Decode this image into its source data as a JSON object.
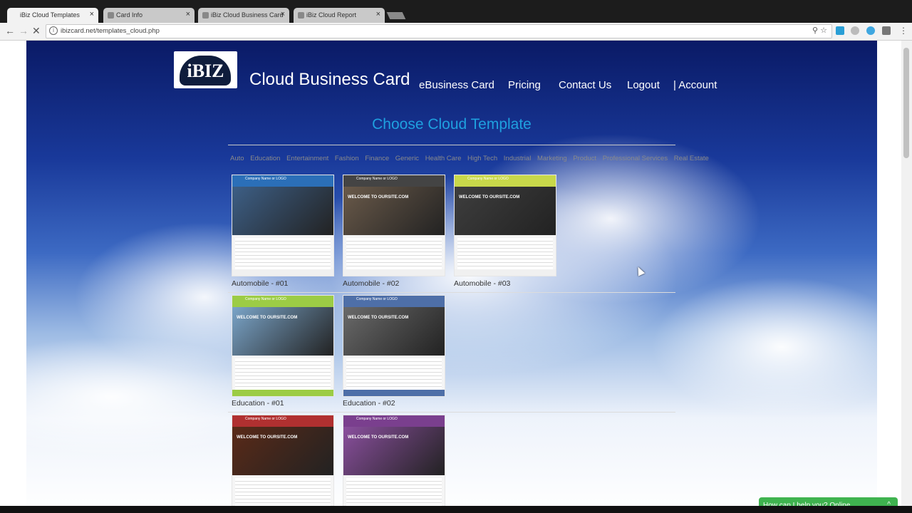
{
  "browser": {
    "tabs": [
      {
        "title": "iBiz Cloud Templates",
        "active": true
      },
      {
        "title": "Card Info",
        "active": false
      },
      {
        "title": "iBiz Cloud Business Card",
        "active": false
      },
      {
        "title": "iBiz Cloud Report",
        "active": false
      }
    ],
    "close_glyph": "×",
    "url": "ibizcard.net/templates_cloud.php"
  },
  "site": {
    "logo_text": "iBIZ",
    "brand_title": "Cloud Business Card",
    "nav": [
      "eBusiness Card",
      "Pricing",
      "Contact Us",
      "Logout",
      "| Account"
    ]
  },
  "templates": {
    "title": "Choose Cloud Template",
    "categories": [
      "Auto",
      "Education",
      "Entertainment",
      "Fashion",
      "Finance",
      "Generic",
      "Health Care",
      "High Tech",
      "Industrial",
      "Marketing",
      "Product",
      "Professional Services",
      "Real Estate"
    ],
    "items": [
      {
        "caption": "Automobile - #01",
        "header_text": "Company Name or LOGO",
        "welcome": "",
        "header_color": "#2b6fb8",
        "photo_color": "#3d5f86",
        "footer_color": "#f0f0f0"
      },
      {
        "caption": "Automobile - #02",
        "header_text": "Company Name or LOGO",
        "welcome": "WELCOME TO OURSITE.COM",
        "header_color": "#444444",
        "photo_color": "#6a5a4a",
        "footer_color": "#f0f0f0"
      },
      {
        "caption": "Automobile - #03",
        "header_text": "Company Name or LOGO",
        "welcome": "WELCOME TO OURSITE.COM",
        "header_color": "#c8d84a",
        "photo_color": "#3e3e3e",
        "footer_color": "#f0f0f0"
      },
      {
        "caption": "Education - #01",
        "header_text": "Company Name or LOGO",
        "welcome": "WELCOME TO OURSITE.COM",
        "header_color": "#9ccc45",
        "photo_color": "#7aa4c8",
        "footer_color": "#9ccc45"
      },
      {
        "caption": "Education - #02",
        "header_text": "Company Name or LOGO",
        "welcome": "WELCOME TO OURSITE.COM",
        "header_color": "#4e6fa8",
        "photo_color": "#6a6a6a",
        "footer_color": "#4e6fa8"
      },
      {
        "caption": "",
        "header_text": "Company Name or LOGO",
        "welcome": "WELCOME TO OURSITE.COM",
        "header_color": "#b03030",
        "photo_color": "#5a2a18",
        "footer_color": "#f0f0f0"
      },
      {
        "caption": "",
        "header_text": "Company Name or LOGO",
        "welcome": "WELCOME TO OURSITE.COM",
        "header_color": "#7a3f8e",
        "photo_color": "#8a4f9e",
        "footer_color": "#f0f0f0"
      }
    ]
  },
  "chat": {
    "label": "How can I help you?   Online",
    "chevron": "^"
  }
}
